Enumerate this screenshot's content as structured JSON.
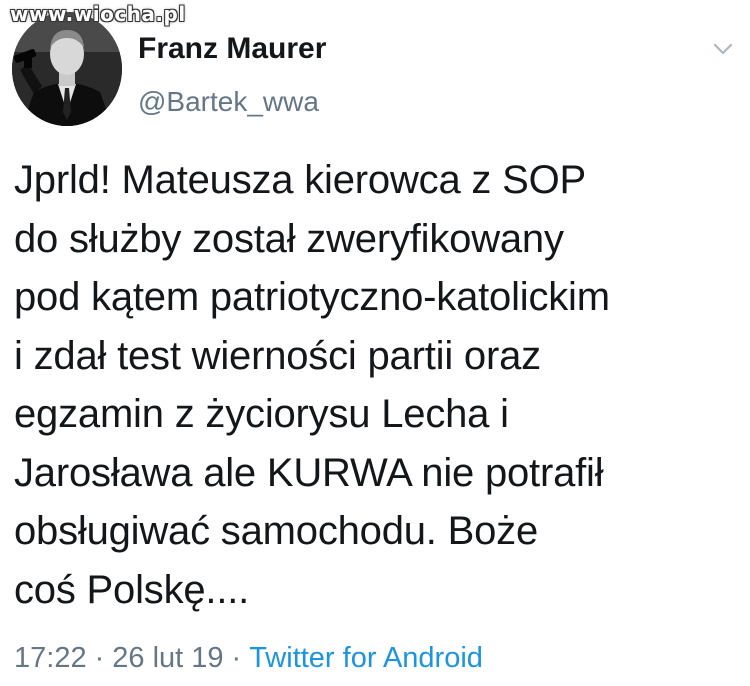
{
  "watermark": "www.wiocha.pl",
  "author": {
    "display_name": "Franz Maurer",
    "handle": "@Bartek_wwa"
  },
  "tweet": {
    "lines": [
      "Jprld! Mateusza kierowca z SOP",
      "do służby został zweryfikowany",
      "pod kątem patriotyczno-katolickim",
      "i zdał test wierności partii oraz",
      "egzamin z życiorysu Lecha i",
      "Jarosława ale KURWA nie potrafił",
      "obsługiwać samochodu. Boże",
      "coś Polskę...."
    ]
  },
  "meta": {
    "time": "17:22",
    "separator": "·",
    "date": "26 lut 19",
    "source": "Twitter for Android"
  },
  "icons": {
    "menu": "chevron-down-icon",
    "avatar": "profile-photo"
  },
  "colors": {
    "text": "#14171a",
    "secondary": "#657786",
    "link": "#1b95e0",
    "background": "#ffffff"
  }
}
